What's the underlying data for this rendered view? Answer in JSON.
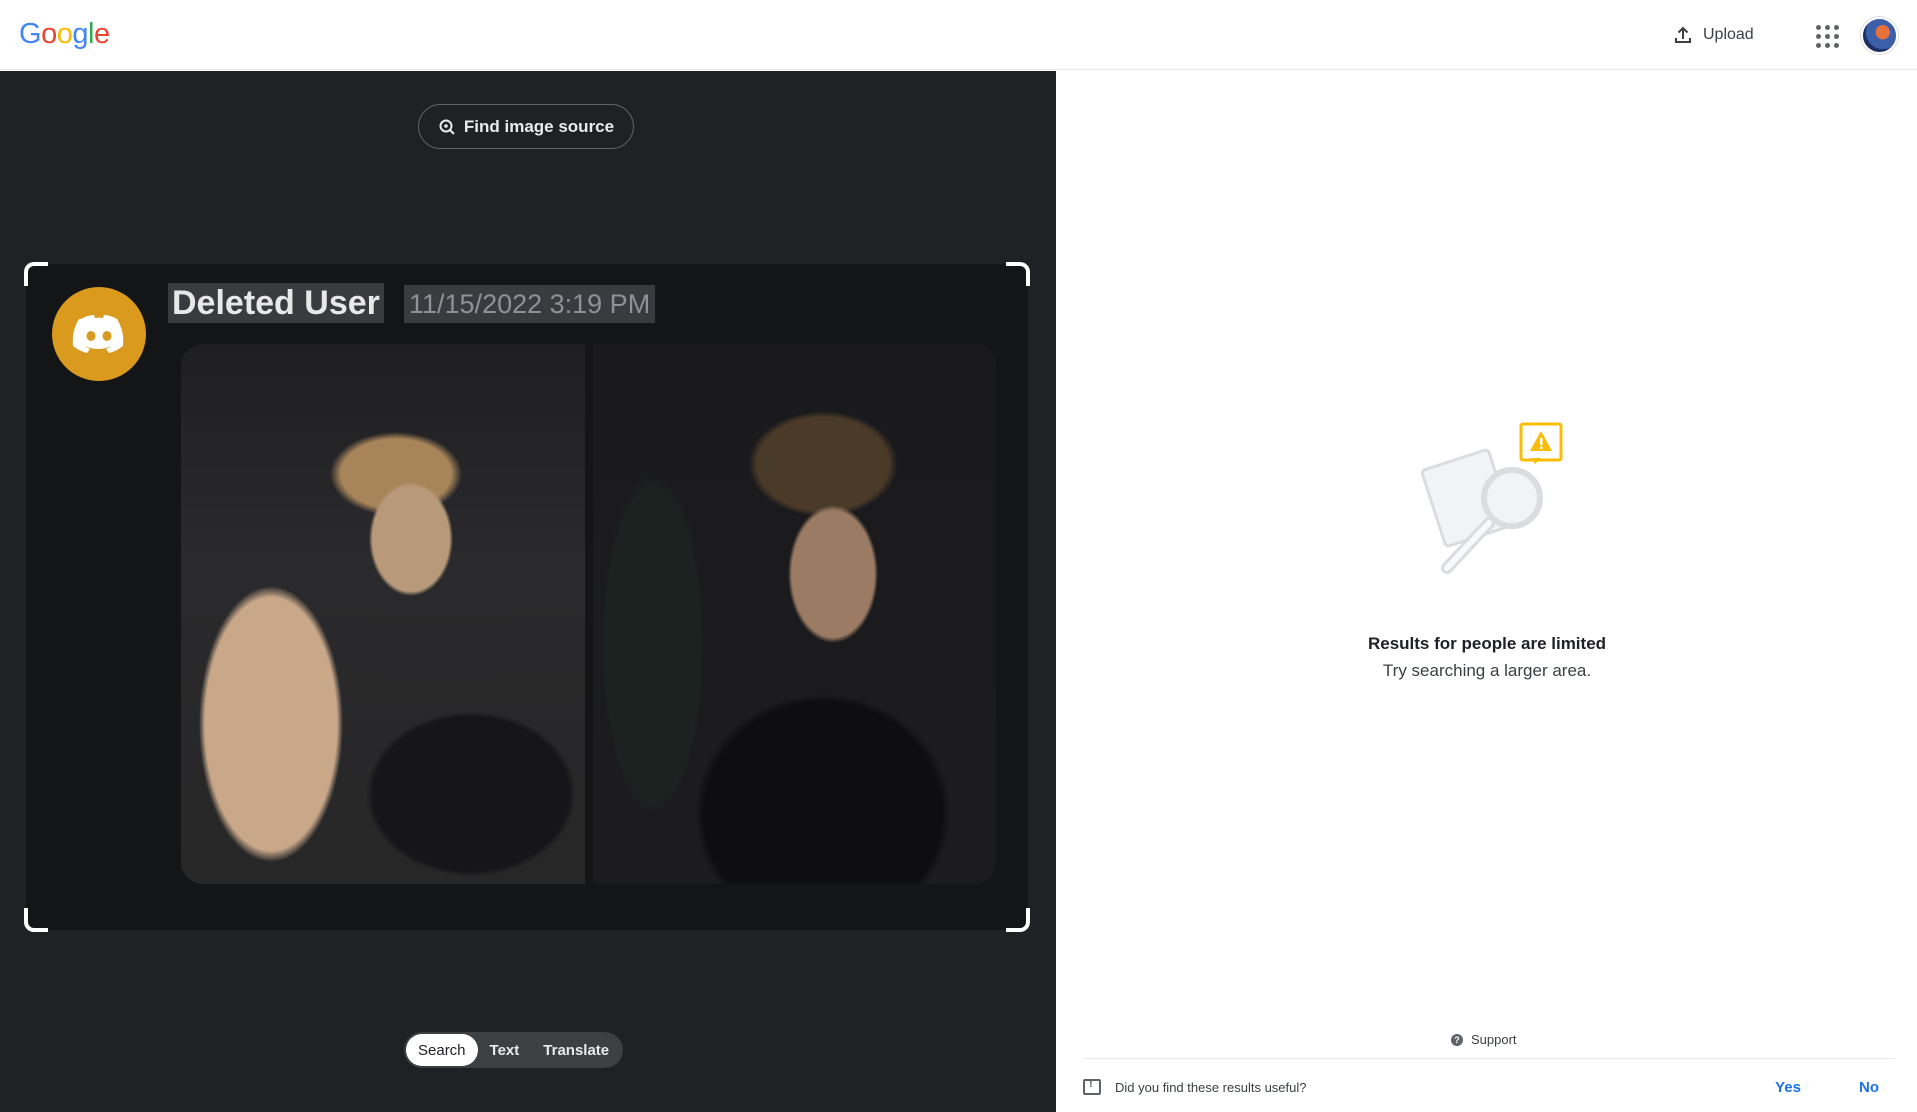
{
  "header": {
    "logo_letters": [
      {
        "char": "G",
        "color": "#4285F4"
      },
      {
        "char": "o",
        "color": "#EA4335"
      },
      {
        "char": "o",
        "color": "#FBBC05"
      },
      {
        "char": "g",
        "color": "#4285F4"
      },
      {
        "char": "l",
        "color": "#34A853"
      },
      {
        "char": "e",
        "color": "#EA4335"
      }
    ],
    "upload_label": "Upload",
    "upload_icon": "upload-icon",
    "apps_icon": "apps-grid-icon",
    "avatar_icon": "account-avatar"
  },
  "lens": {
    "find_source_label": "Find image source",
    "find_source_icon": "lens-search-icon",
    "message": {
      "username": "Deleted User",
      "timestamp": "11/15/2022 3:19 PM",
      "avatar_icon": "discord-logo-icon",
      "avatar_color": "#d99a1e"
    },
    "modes": [
      {
        "label": "Search",
        "active": true
      },
      {
        "label": "Text",
        "active": false
      },
      {
        "label": "Translate",
        "active": false
      }
    ]
  },
  "results": {
    "illustration_icon": "limited-results-illustration",
    "title": "Results for people are limited",
    "subtitle": "Try searching a larger area.",
    "support_label": "Support",
    "feedback_question": "Did you find these results useful?",
    "feedback_yes": "Yes",
    "feedback_no": "No",
    "accent_color": "#1a73e8",
    "warning_color": "#fbbc04"
  }
}
